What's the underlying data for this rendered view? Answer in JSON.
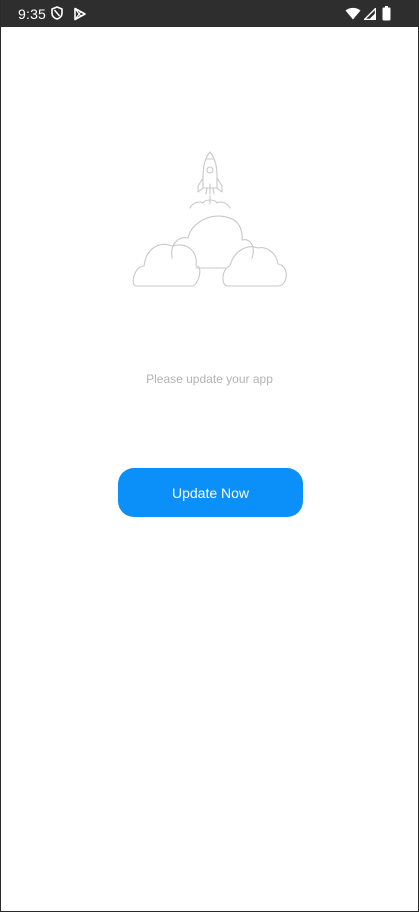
{
  "status_bar": {
    "time": "9:35",
    "left_icons": [
      "shield-icon",
      "play-store-icon"
    ],
    "right_icons": [
      "wifi-icon",
      "signal-icon",
      "battery-icon"
    ]
  },
  "main": {
    "illustration": "rocket-launch-clouds",
    "message": "Please update your app",
    "button_label": "Update Now"
  },
  "colors": {
    "status_bar_bg": "#2e2e2e",
    "accent": "#0a90f8",
    "message_text": "#b3b3b3",
    "illustration_stroke": "#c8c8c8"
  }
}
